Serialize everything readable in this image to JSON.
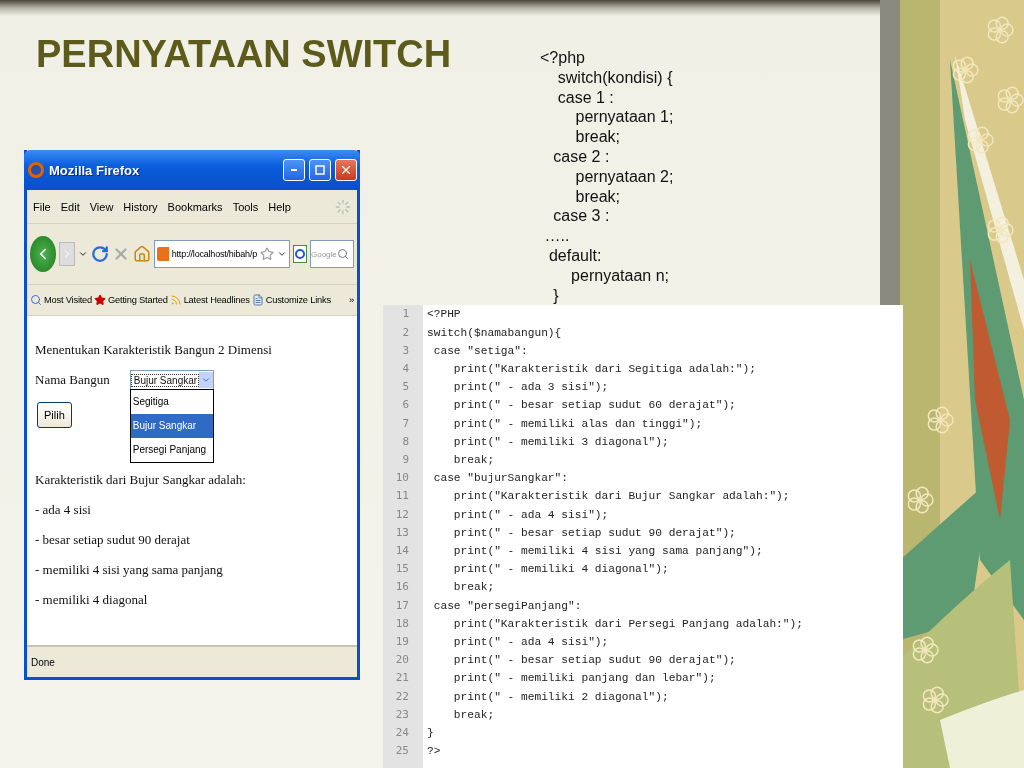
{
  "slide": {
    "title": "PERNYATAAN SWITCH"
  },
  "syntax_lines": [
    "<?php",
    "    switch(kondisi) {",
    "    case 1 :",
    "        pernyataan 1;",
    "        break;",
    "   case 2 :",
    "        pernyataan 2;",
    "        break;",
    "   case 3 :",
    " …..",
    "  default:",
    "       pernyataan n;",
    "   }"
  ],
  "browser": {
    "title": "Mozilla Firefox",
    "menu": [
      "File",
      "Edit",
      "View",
      "History",
      "Bookmarks",
      "Tools",
      "Help"
    ],
    "address": "http://localhost/hibah/p",
    "search_placeholder": "Google",
    "bookmarks": [
      "Most Visited",
      "Getting Started",
      "Latest Headlines",
      "Customize Links"
    ],
    "overflow": "»",
    "page": {
      "heading": "Menentukan Karakteristik Bangun 2 Dimensi",
      "field_label": "Nama Bangun",
      "select_value": "Bujur Sangkar",
      "options": [
        {
          "label": "Segitiga",
          "selected": false
        },
        {
          "label": "Bujur Sangkar",
          "selected": true
        },
        {
          "label": "Persegi Panjang",
          "selected": false
        }
      ],
      "button": "Pilih",
      "result_title": "Karakteristik dari Bujur Sangkar adalah:",
      "result_lines": [
        "- ada 4 sisi",
        "- besar setiap sudut 90 derajat",
        "- memiliki 4 sisi yang sama panjang",
        "- memiliki 4 diagonal"
      ]
    },
    "status": "Done"
  },
  "code": {
    "lines": [
      {
        "number": "1",
        "text": "<?PHP"
      },
      {
        "number": "2",
        "text": "switch($namabangun){"
      },
      {
        "number": "3",
        "text": " case \"setiga\":"
      },
      {
        "number": "4",
        "text": "    print(\"Karakteristik dari Segitiga adalah:\");"
      },
      {
        "number": "5",
        "text": "    print(\" - ada 3 sisi\");"
      },
      {
        "number": "6",
        "text": "    print(\" - besar setiap sudut 60 derajat\");"
      },
      {
        "number": "7",
        "text": "    print(\" - memiliki alas dan tinggi\");"
      },
      {
        "number": "8",
        "text": "    print(\" - memiliki 3 diagonal\");"
      },
      {
        "number": "9",
        "text": "    break;"
      },
      {
        "number": "10",
        "text": " case \"bujurSangkar\":"
      },
      {
        "number": "11",
        "text": "    print(\"Karakteristik dari Bujur Sangkar adalah:\");"
      },
      {
        "number": "12",
        "text": "    print(\" - ada 4 sisi\");"
      },
      {
        "number": "13",
        "text": "    print(\" - besar setiap sudut 90 derajat\");"
      },
      {
        "number": "14",
        "text": "    print(\" - memiliki 4 sisi yang sama panjang\");"
      },
      {
        "number": "15",
        "text": "    print(\" - memiliki 4 diagonal\");"
      },
      {
        "number": "16",
        "text": "    break;"
      },
      {
        "number": "17",
        "text": " case \"persegiPanjang\":"
      },
      {
        "number": "18",
        "text": "    print(\"Karakteristik dari Persegi Panjang adalah:\");"
      },
      {
        "number": "19",
        "text": "    print(\" - ada 4 sisi\");"
      },
      {
        "number": "20",
        "text": "    print(\" - besar setiap sudut 90 derajat\");"
      },
      {
        "number": "21",
        "text": "    print(\" - memiliki panjang dan lebar\");"
      },
      {
        "number": "22",
        "text": "    print(\" - memiliki 2 diagonal\");"
      },
      {
        "number": "23",
        "text": "    break;"
      },
      {
        "number": "24",
        "text": "}"
      },
      {
        "number": "25",
        "text": "?>"
      }
    ]
  }
}
